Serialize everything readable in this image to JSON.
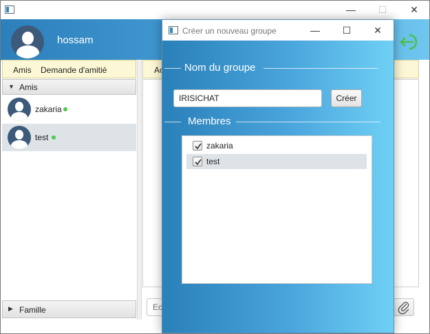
{
  "main_window": {
    "minimize_glyph": "—",
    "maximize_glyph": "☐",
    "close_glyph": "✕",
    "icons": {
      "app": "app-window-icon",
      "logout": "logout-arrow-icon"
    }
  },
  "header": {
    "username": "hossam",
    "accent_color": "#2c7fbb"
  },
  "left_pane": {
    "tabs": [
      {
        "label": "Amis"
      },
      {
        "label": "Demande d'amitié"
      }
    ],
    "groups": [
      {
        "label": "Amis",
        "expanded": true
      },
      {
        "label": "Famille",
        "expanded": false
      }
    ],
    "friends": [
      {
        "name": "zakaria",
        "online": true,
        "selected": false
      },
      {
        "name": "test",
        "online": true,
        "selected": true
      }
    ],
    "status_color": "#4cc94c"
  },
  "right_pane": {
    "tab_label": "Ac",
    "message_placeholder": "Ec"
  },
  "dialog": {
    "title": "Créer un nouveau groupe",
    "minimize_glyph": "—",
    "maximize_glyph": "☐",
    "close_glyph": "✕",
    "group_name_label": "Nom du groupe",
    "group_name_value": "IRISICHAT",
    "create_button_label": "Créer",
    "members_label": "Membres",
    "members": [
      {
        "name": "zakaria",
        "checked": true,
        "selected": false
      },
      {
        "name": "test",
        "checked": true,
        "selected": true
      }
    ]
  }
}
